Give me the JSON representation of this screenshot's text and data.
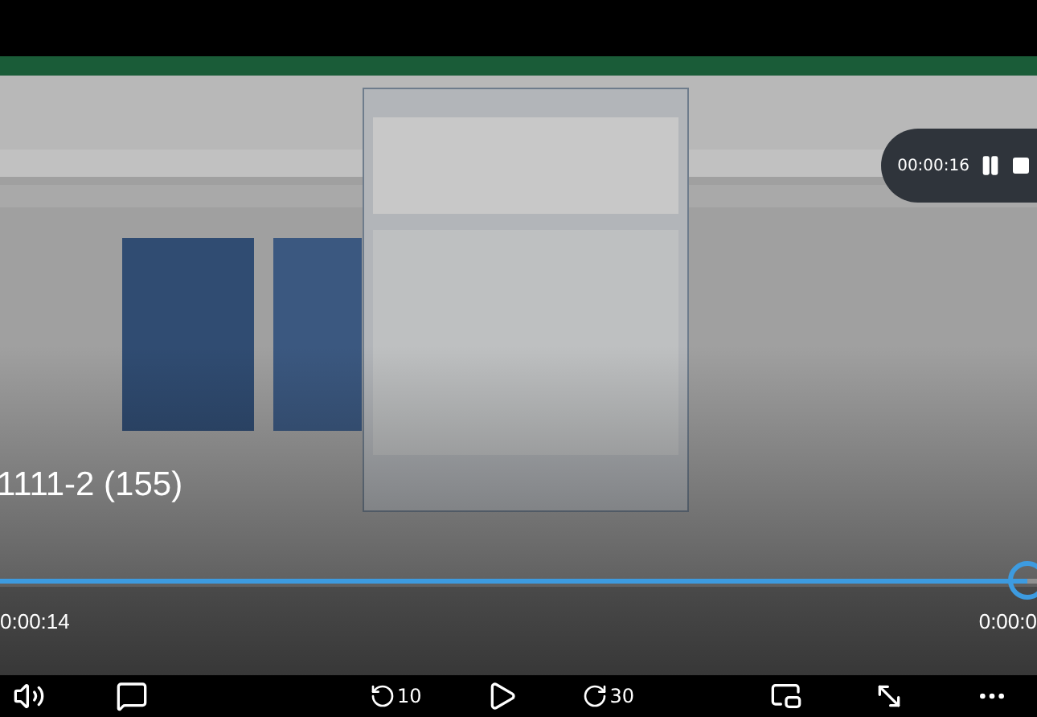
{
  "title": "1111-2 (155)",
  "timer": {
    "time": "00:00:16"
  },
  "progress": {
    "level": 0.99
  },
  "elapsed": "0:00:14",
  "duration": "0:00:0",
  "controls": {
    "rewind": "10",
    "forward": "30"
  }
}
